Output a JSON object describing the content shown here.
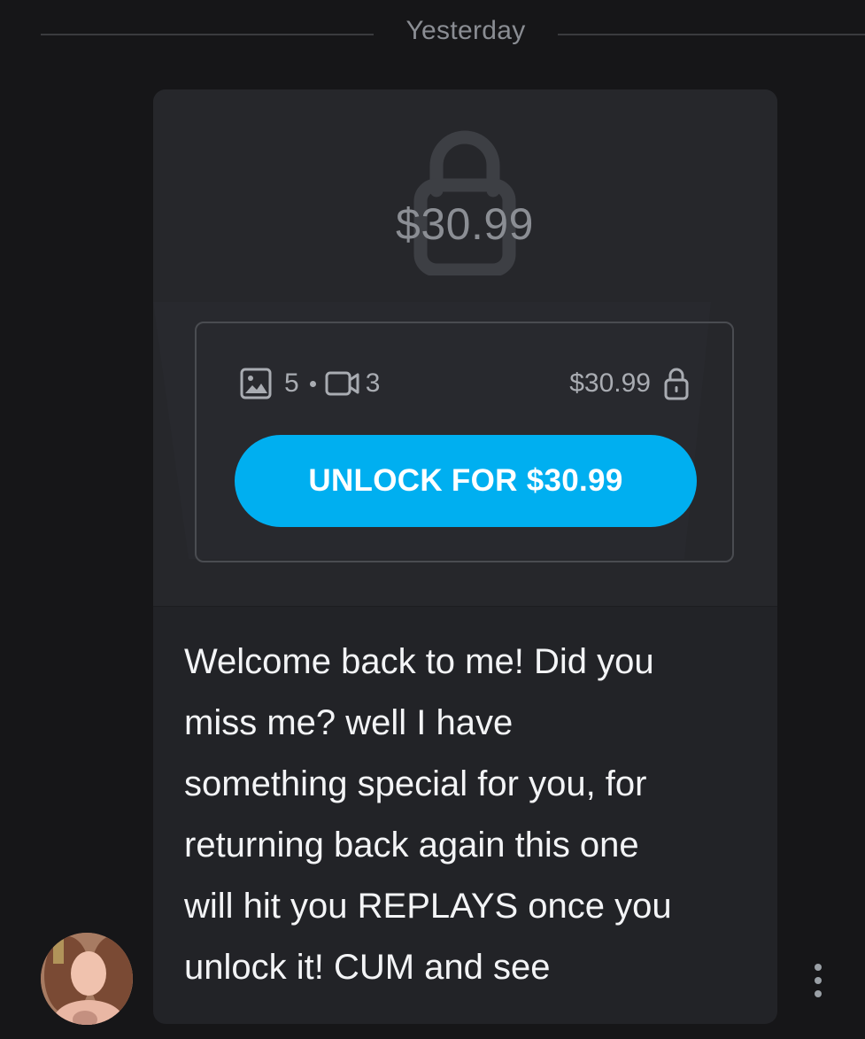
{
  "date_separator": {
    "label": "Yesterday"
  },
  "locked_post": {
    "price": "$30.99",
    "photo_count": "5",
    "video_count": "3",
    "price_small": "$30.99",
    "unlock_button_label": "UNLOCK FOR $30.99"
  },
  "message": {
    "text": "Welcome back to me! Did you\nmiss me? well I have\nsomething special for you, for\nreturning back again this one\nwill hit you REPLAYS once you\nunlock it! CUM and see"
  },
  "colors": {
    "background": "#161618",
    "card": "#222327",
    "accent": "#00aff0",
    "muted_text": "#8a8d93"
  },
  "icons": [
    "lock-icon",
    "image-icon",
    "video-icon",
    "small-lock-icon",
    "more-vertical-icon"
  ]
}
